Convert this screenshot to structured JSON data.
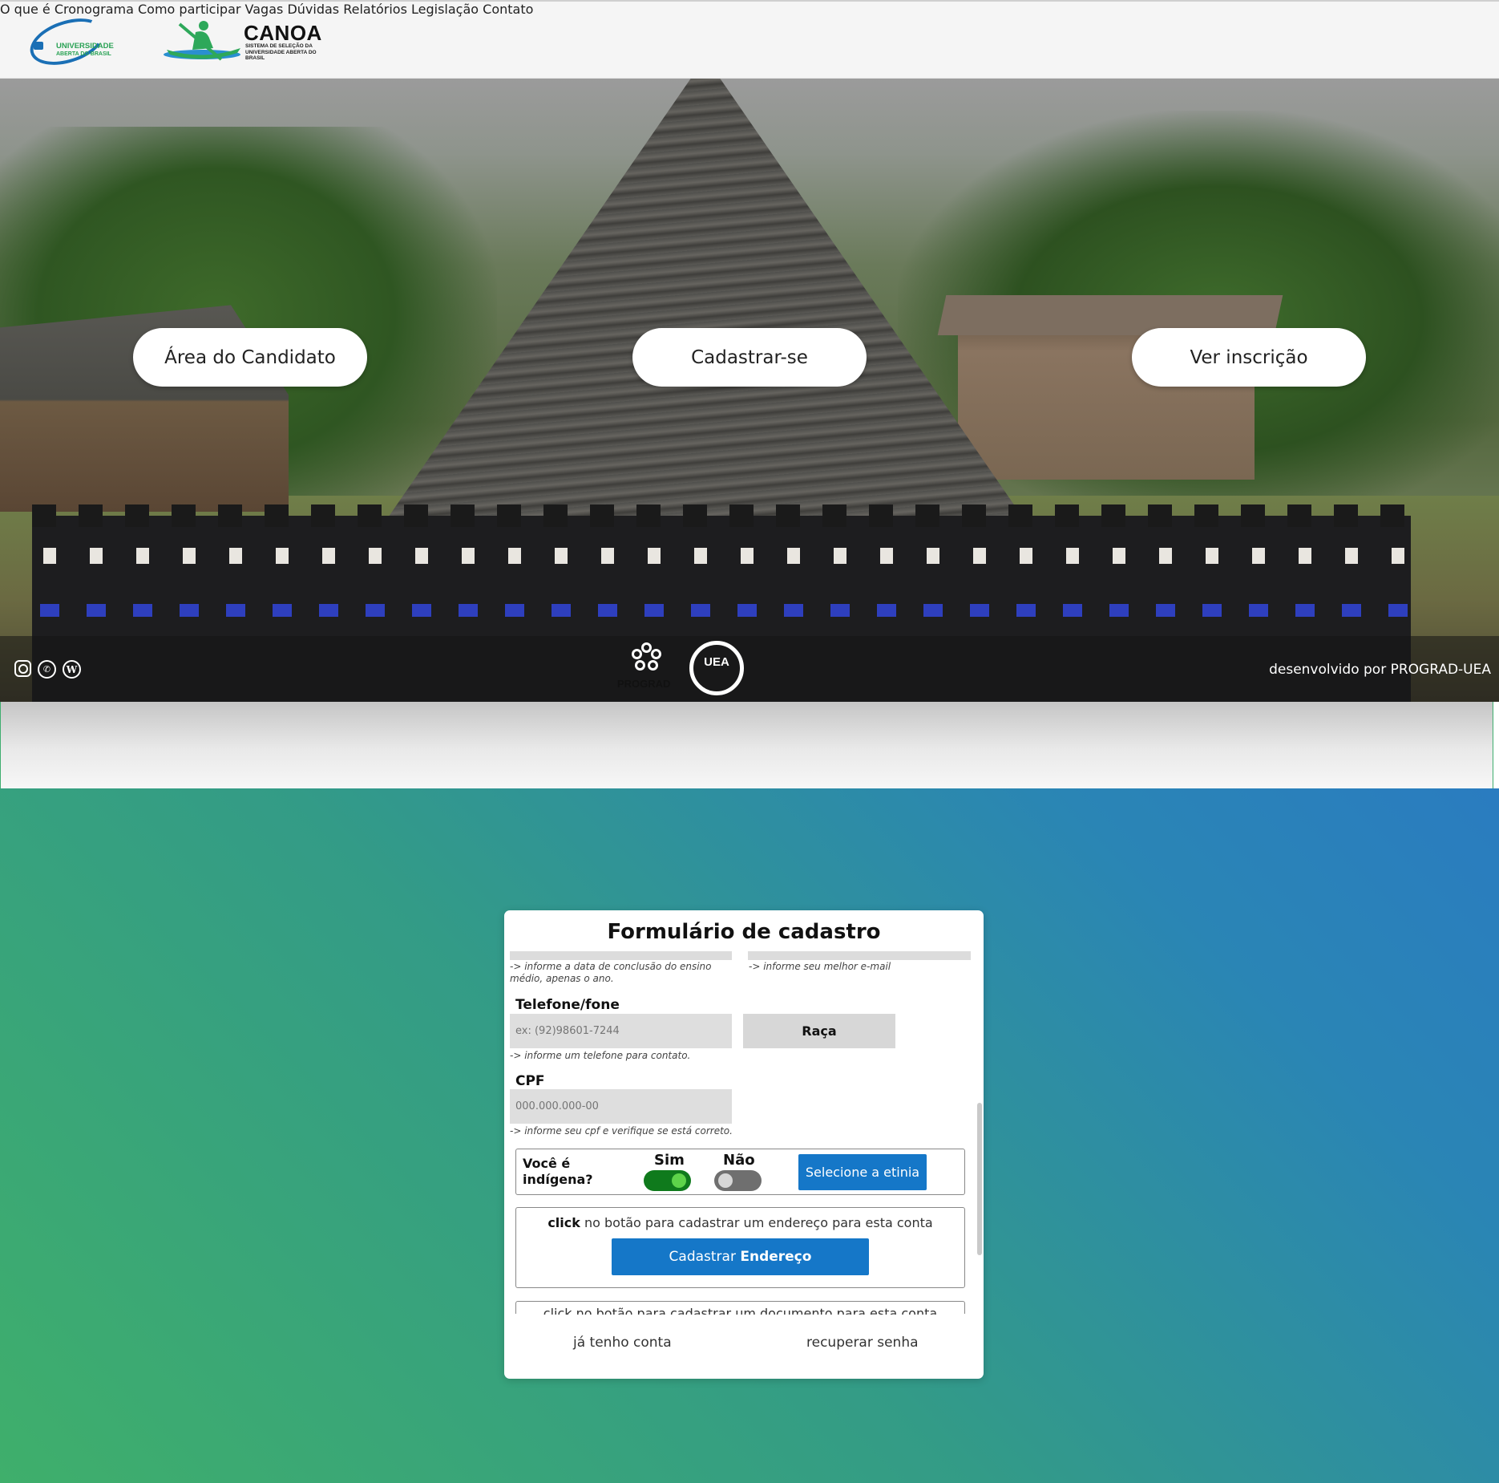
{
  "nav": {
    "logo_uab_text": "UNIVERSIDADE",
    "logo_uab_sub": "ABERTA DO BRASIL",
    "logo_canoa_name": "CANOA",
    "logo_canoa_sub": "SISTEMA DE SELEÇÃO DA UNIVERSIDADE ABERTA DO BRASIL",
    "items": [
      {
        "label": "O que é"
      },
      {
        "label": "Cronograma"
      },
      {
        "label": "Como participar"
      },
      {
        "label": "Vagas"
      },
      {
        "label": "Dúvidas"
      },
      {
        "label": "Relatórios"
      },
      {
        "label": "Legislação"
      },
      {
        "label": "Contato"
      }
    ]
  },
  "hero": {
    "buttons": {
      "area_candidato": "Área do Candidato",
      "cadastrar": "Cadastrar-se",
      "ver_inscricao": "Ver inscrição"
    },
    "social": [
      "instagram-icon",
      "whatsapp-icon",
      "wordpress-icon"
    ],
    "prograd_label": "PROGRAD",
    "uea_label": "UEA",
    "credit": "desenvolvido por PROGRAD-UEA"
  },
  "form": {
    "title": "Formulário de cadastro",
    "hint_conclusao": "-> informe a data de conclusão do ensino médio, apenas o ano.",
    "hint_email": "-> informe seu melhor e-mail",
    "telefone_label": "Telefone/fone",
    "telefone_placeholder": "ex: (92)98601-7244",
    "telefone_hint": "-> informe um telefone para contato.",
    "raca_button": "Raça",
    "cpf_label": "CPF",
    "cpf_placeholder": "000.000.000-00",
    "cpf_hint": "-> informe seu cpf e verifique se está correto.",
    "indigena_question": "Você é indígena?",
    "sim_label": "Sim",
    "nao_label": "Não",
    "sim_on": true,
    "nao_on": false,
    "etnia_button": "Selecione a etinia",
    "endereco_click": "click",
    "endereco_text": "no botão para cadastrar um endereço para esta conta",
    "endereco_button_prefix": "Cadastrar",
    "endereco_button_bold": "Endereço",
    "cut_text": "click no botão para cadastrar um documento para esta conta",
    "link_ja_tenho": "já tenho conta",
    "link_recuperar": "recuperar senha"
  },
  "colors": {
    "gradient_start": "#3faf6b",
    "gradient_end": "#2a7cc0",
    "button_blue": "#1577c8",
    "toggle_on": "#0f7a1c"
  }
}
